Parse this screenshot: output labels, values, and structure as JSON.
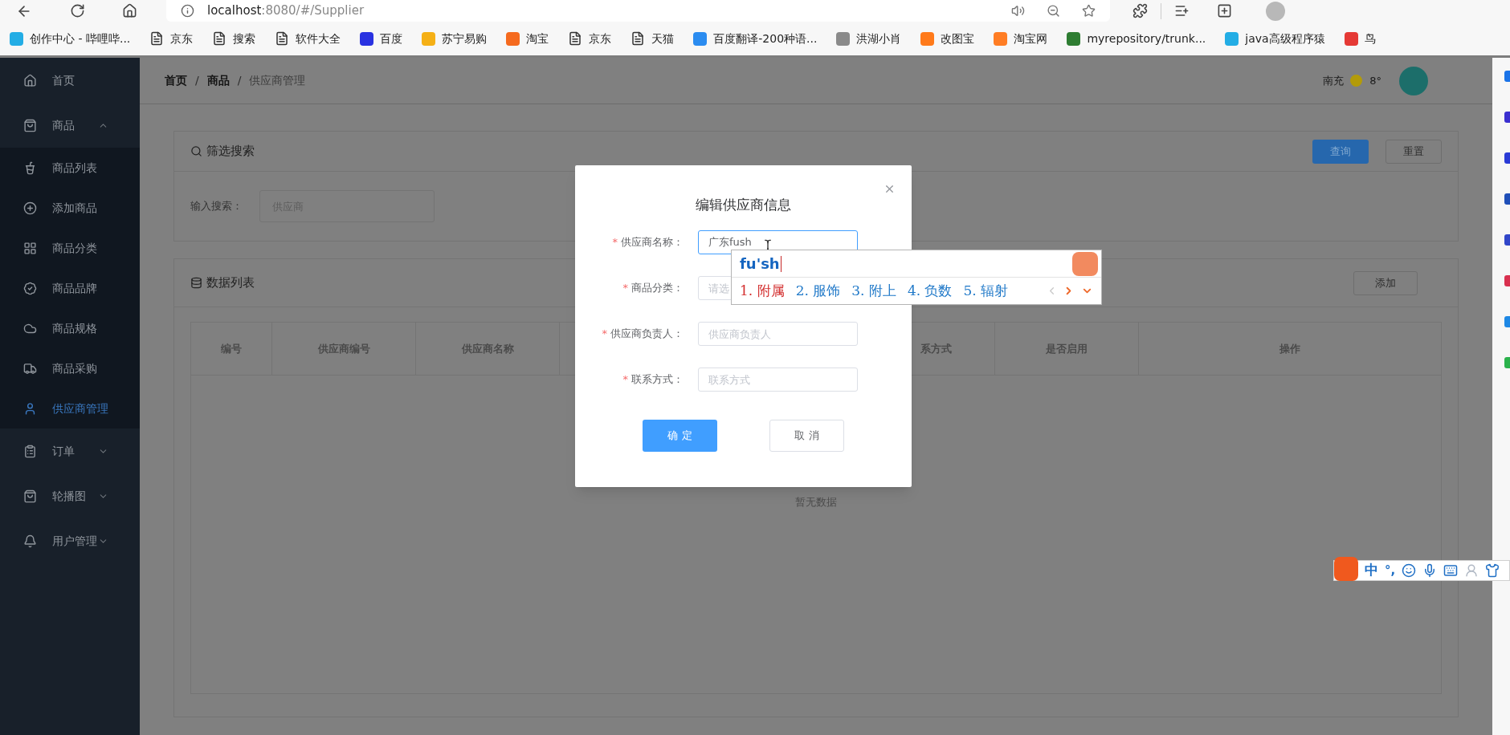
{
  "browser": {
    "address": {
      "host": "localhost",
      "path": ":8080/#/Supplier"
    }
  },
  "bookmarks": [
    {
      "kind": "logo",
      "color": "#23ade5",
      "label": "创作中心 - 哔哩哔..."
    },
    {
      "kind": "page",
      "label": "京东"
    },
    {
      "kind": "page",
      "label": "搜索"
    },
    {
      "kind": "page",
      "label": "软件大全"
    },
    {
      "kind": "logo",
      "color": "#2932e1",
      "label": "百度"
    },
    {
      "kind": "logo",
      "color": "#f5b016",
      "label": "苏宁易购"
    },
    {
      "kind": "logo",
      "color": "#f56a1e",
      "label": "淘宝"
    },
    {
      "kind": "page",
      "label": "京东"
    },
    {
      "kind": "page",
      "label": "天猫"
    },
    {
      "kind": "logo",
      "color": "#2b8cf0",
      "label": "百度翻译-200种语..."
    },
    {
      "kind": "logo",
      "color": "#8a8a8a",
      "label": "洪湖小肖"
    },
    {
      "kind": "logo",
      "color": "#ff7a1a",
      "label": "改图宝"
    },
    {
      "kind": "logo",
      "color": "#ff7d24",
      "label": "淘宝网"
    },
    {
      "kind": "logo",
      "color": "#2e7d32",
      "label": "myrepository/trunk..."
    },
    {
      "kind": "logo",
      "color": "#23ade5",
      "label": "java高级程序猿"
    },
    {
      "kind": "logo",
      "color": "#e53935",
      "label": "鸟"
    }
  ],
  "sidebar": {
    "items": [
      {
        "label": "首页",
        "selected": false
      },
      {
        "label": "商品",
        "selected": false,
        "expanded": true,
        "children": [
          {
            "label": "商品列表",
            "selected": false
          },
          {
            "label": "添加商品",
            "selected": false
          },
          {
            "label": "商品分类",
            "selected": false
          },
          {
            "label": "商品品牌",
            "selected": false
          },
          {
            "label": "商品规格",
            "selected": false
          },
          {
            "label": "商品采购",
            "selected": false
          },
          {
            "label": "供应商管理",
            "selected": true
          }
        ]
      },
      {
        "label": "订单",
        "selected": false,
        "expanded": false
      },
      {
        "label": "轮播图",
        "selected": false,
        "expanded": false
      },
      {
        "label": "用户管理",
        "selected": false,
        "expanded": false
      }
    ]
  },
  "header": {
    "breadcrumb": [
      {
        "label": "首页",
        "current": false
      },
      {
        "label": "商品",
        "current": false
      },
      {
        "label": "供应商管理",
        "current": true
      }
    ],
    "separator": "/",
    "city": "南充",
    "temperature": "8°"
  },
  "filter_card": {
    "title": "筛选搜索",
    "buttons": [
      {
        "label": "查询",
        "kind": "primary"
      },
      {
        "label": "重置",
        "kind": "default"
      }
    ],
    "search_label": "输入搜索：",
    "search_placeholder": "供应商"
  },
  "data_card": {
    "title": "数据列表",
    "add_button": "添加",
    "columns": [
      "编号",
      "供应商编号",
      "供应商名称",
      "系方式",
      "是否启用",
      "操作"
    ],
    "empty_text": "暂无数据"
  },
  "dialog": {
    "title": "编辑供应商信息",
    "required_mark": "*",
    "fields": [
      {
        "label": "供应商名称：",
        "required": true,
        "value": "广东fush",
        "focused": true
      },
      {
        "label": "商品分类：",
        "required": true,
        "placeholder": "请选",
        "focused": false
      },
      {
        "label": "供应商负责人：",
        "required": true,
        "placeholder": "供应商负责人",
        "focused": false
      },
      {
        "label": "联系方式：",
        "required": true,
        "placeholder": "联系方式",
        "focused": false
      }
    ],
    "buttons": [
      {
        "label": "确 定",
        "kind": "primary"
      },
      {
        "label": "取 消",
        "kind": "default"
      }
    ]
  },
  "ime": {
    "composition": "fu'sh",
    "candidates": [
      {
        "label": "1. 附属",
        "selected": true
      },
      {
        "label": "2. 服饰",
        "selected": false
      },
      {
        "label": "3. 附上",
        "selected": false
      },
      {
        "label": "4. 负数",
        "selected": false
      },
      {
        "label": "5. 辐射",
        "selected": false
      }
    ]
  },
  "ime_toolbar": {
    "mode": "中",
    "punctuation": "°,"
  }
}
